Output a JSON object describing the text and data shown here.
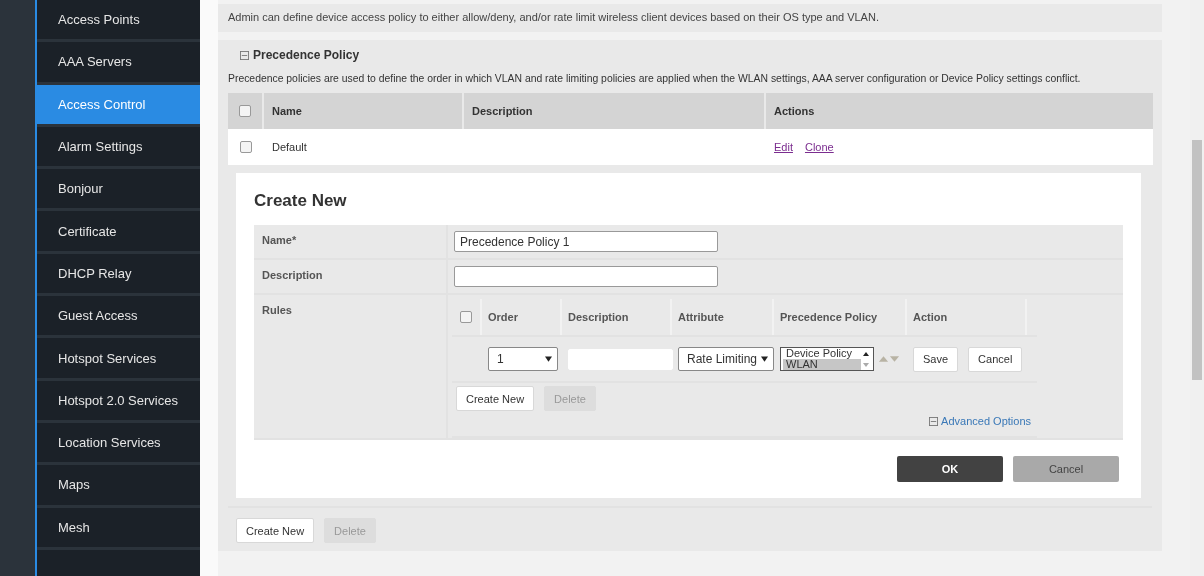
{
  "sidebar": {
    "items": [
      {
        "label": "Access Points",
        "selected": false
      },
      {
        "label": "AAA Servers",
        "selected": false
      },
      {
        "label": "Access Control",
        "selected": true
      },
      {
        "label": "Alarm Settings",
        "selected": false
      },
      {
        "label": "Bonjour",
        "selected": false
      },
      {
        "label": "Certificate",
        "selected": false
      },
      {
        "label": "DHCP Relay",
        "selected": false
      },
      {
        "label": "Guest Access",
        "selected": false
      },
      {
        "label": "Hotspot Services",
        "selected": false
      },
      {
        "label": "Hotspot 2.0 Services",
        "selected": false
      },
      {
        "label": "Location Services",
        "selected": false
      },
      {
        "label": "Maps",
        "selected": false
      },
      {
        "label": "Mesh",
        "selected": false
      }
    ]
  },
  "intro": "Admin can define device access policy to either allow/deny, and/or rate limit wireless client devices based on their OS type and VLAN.",
  "section": {
    "title": "Precedence Policy",
    "expanded": true,
    "description": "Precedence policies are used to define the order in which VLAN and rate limiting policies are applied when the WLAN settings, AAA server configuration or Device Policy settings conflict.",
    "table": {
      "columns": [
        "Name",
        "Description",
        "Actions"
      ],
      "all_checked": false,
      "rows": [
        {
          "name": "Default",
          "checked": false,
          "actions": [
            "Edit",
            "Clone"
          ]
        }
      ]
    },
    "buttons": [
      {
        "label": "Create New",
        "disabled": false
      },
      {
        "label": "Delete",
        "disabled": true
      }
    ]
  },
  "create_new": {
    "title": "Create New",
    "fields": [
      {
        "label": "Name*",
        "value": "Precedence Policy 1"
      },
      {
        "label": "Description"
      }
    ],
    "rules": {
      "label": "Rules",
      "columns": [
        "Order",
        "Description",
        "Attribute",
        "Precedence Policy",
        "Action"
      ],
      "all_checked": false,
      "row": {
        "order": "1",
        "attribute": "Rate Limiting",
        "policy_options": [
          {
            "label": "Device Policy",
            "selected": false
          },
          {
            "label": "WLAN",
            "selected": true
          }
        ],
        "actions": [
          "Save",
          "Cancel"
        ]
      },
      "buttons": [
        {
          "label": "Create New",
          "disabled": false
        },
        {
          "label": "Delete",
          "disabled": true
        }
      ],
      "advanced_options": {
        "label": "Advanced Options",
        "expanded": true
      }
    },
    "buttons": [
      {
        "label": "OK",
        "kind": "primary"
      },
      {
        "label": "Cancel",
        "kind": "secondary"
      }
    ]
  }
}
